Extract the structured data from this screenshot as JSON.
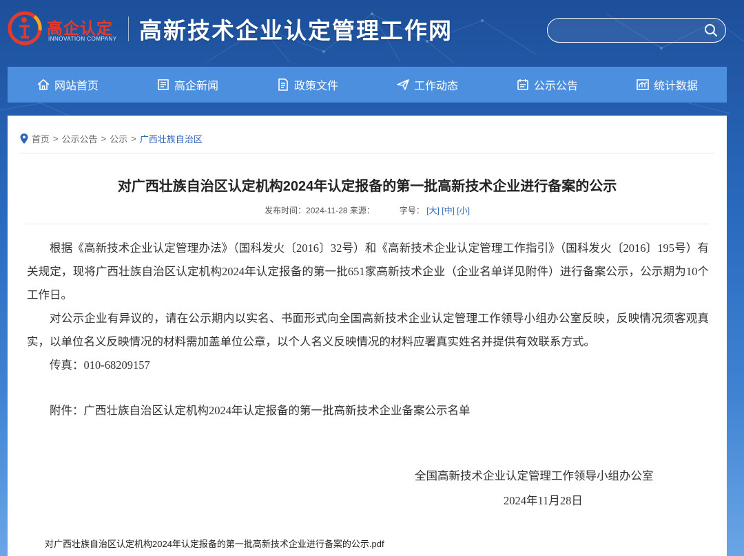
{
  "header": {
    "logo_cn": "高企认定",
    "logo_en": "INNOVATION COMPANY",
    "site_title": "高新技术企业认定管理工作网",
    "search_placeholder": ""
  },
  "nav": {
    "items": [
      {
        "label": "网站首页",
        "icon": "home-icon"
      },
      {
        "label": "高企新闻",
        "icon": "news-icon"
      },
      {
        "label": "政策文件",
        "icon": "document-icon"
      },
      {
        "label": "工作动态",
        "icon": "send-icon"
      },
      {
        "label": "公示公告",
        "icon": "announcement-icon"
      },
      {
        "label": "统计数据",
        "icon": "chart-icon"
      }
    ]
  },
  "breadcrumb": {
    "items": [
      "首页",
      "公示公告",
      "公示",
      "广西壮族自治区"
    ],
    "separator": ">"
  },
  "article": {
    "title": "对广西壮族自治区认定机构2024年认定报备的第一批高新技术企业进行备案的公示",
    "publish_time": "发布时间：2024-11-28 来源：",
    "font_size_label": "字号：",
    "size_large": "[大]",
    "size_medium": "[中]",
    "size_small": "[小]",
    "paragraphs": [
      "根据《高新技术企业认定管理办法》（国科发火〔2016〕32号）和《高新技术企业认定管理工作指引》（国科发火〔2016〕195号）有关规定，现将广西壮族自治区认定机构2024年认定报备的第一批651家高新技术企业（企业名单详见附件）进行备案公示，公示期为10个工作日。",
      "对公示企业有异议的，请在公示期内以实名、书面形式向全国高新技术企业认定管理工作领导小组办公室反映，反映情况须客观真实，以单位名义反映情况的材料需加盖单位公章，以个人名义反映情况的材料应署真实姓名并提供有效联系方式。"
    ],
    "fax": "传真：010-68209157",
    "attachment": "附件：广西壮族自治区认定机构2024年认定报备的第一批高新技术企业备案公示名单",
    "signature": "全国高新技术企业认定管理工作领导小组办公室",
    "date": "2024年11月28日",
    "attachment_file": "对广西壮族自治区认定机构2024年认定报备的第一批高新技术企业进行备案的公示.pdf"
  },
  "colors": {
    "nav_bg": "#4d8fdf",
    "accent_link": "#2a63b8",
    "logo_red": "#e23b2e"
  }
}
